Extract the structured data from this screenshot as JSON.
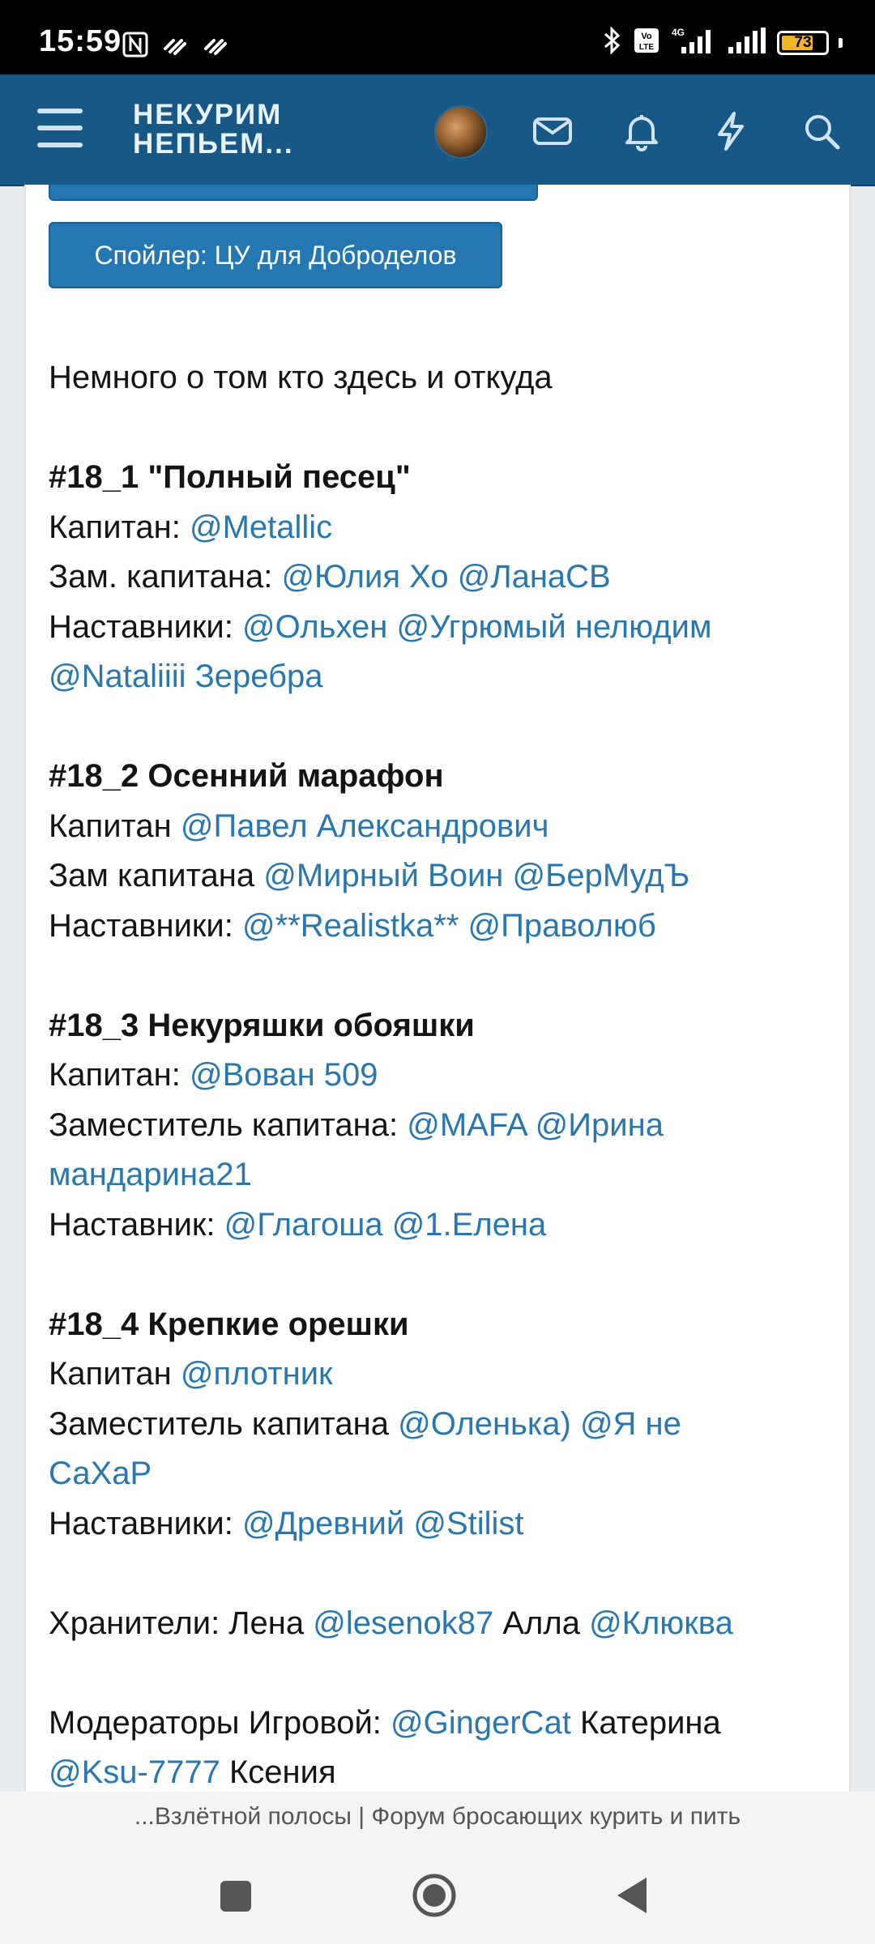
{
  "status_bar": {
    "time": "15:59",
    "network": "4G",
    "volte": "Vo LTE",
    "battery_level": "73"
  },
  "header": {
    "logo_line1": "НЕКУРИМ",
    "logo_line2": "НЕПЬЕМ..."
  },
  "spoiler": {
    "label": "Спойлер: ЦУ для Доброделов"
  },
  "post": {
    "intro": "Немного о том кто здесь и откуда",
    "team1_title": "#18_1 \"Полный песец\"",
    "team1_captain_label": "Капитан: ",
    "team1_captain": "@Metallic",
    "team1_deputy_label": "Зам. капитана: ",
    "team1_deputy_1": "@Юлия Хо",
    "team1_deputy_2": "@ЛанаСВ",
    "team1_mentors_label": "Наставники: ",
    "team1_mentor_1": "@Ольхен",
    "team1_mentor_2": "@Угрюмый нелюдим",
    "team1_mentor_3": "@Nataliiii Зеребра",
    "team2_title": "#18_2 Осенний марафон",
    "team2_captain_label": "Капитан ",
    "team2_captain": "@Павел Александрович",
    "team2_deputy_label": "Зам капитана ",
    "team2_deputy_1": "@Мирный Воин",
    "team2_deputy_2": "@БерМудЪ",
    "team2_mentors_label": "Наставники: ",
    "team2_mentor_1": "@**Realistka**",
    "team2_mentor_2": "@Праволюб",
    "team3_title": "#18_3 Некуряшки обояшки",
    "team3_captain_label": "Капитан: ",
    "team3_captain": "@Вован 509",
    "team3_deputy_label": "Заместитель капитана: ",
    "team3_deputy_1": "@MAFA",
    "team3_deputy_2a": "@Ирина",
    "team3_deputy_2b": "мандарина21",
    "team3_mentors_label": "Наставник: ",
    "team3_mentor_1": "@Глагоша",
    "team3_mentor_2": "@1.Елена",
    "team4_title": "#18_4 Крепкие орешки",
    "team4_captain_label": "Капитан ",
    "team4_captain": "@плотник",
    "team4_deputy_label": "Заместитель капитана ",
    "team4_deputy_1": "@Оленька)",
    "team4_deputy_2a": "@Я не",
    "team4_deputy_2b": "СаХаР",
    "team4_mentors_label": "Наставники: ",
    "team4_mentor_1": "@Древний",
    "team4_mentor_2": "@Stilist",
    "keepers_label": "Хранители: Лена ",
    "keeper_1": "@lesenok87",
    "keepers_mid": " Алла ",
    "keeper_2": "@Клюква",
    "moderators_label": "Модераторы Игровой: ",
    "moderator_1": "@GingerCat",
    "moderator_1_name": " Катерина",
    "moderator_2": "@Ksu-7777",
    "moderator_2_name": " Ксения"
  },
  "footer": {
    "page_title": "...Взлётной полосы | Форум бросающих курить и пить"
  },
  "colors": {
    "header": "#185886",
    "mention": "#2a77b0",
    "spoiler": "#2577b1"
  }
}
